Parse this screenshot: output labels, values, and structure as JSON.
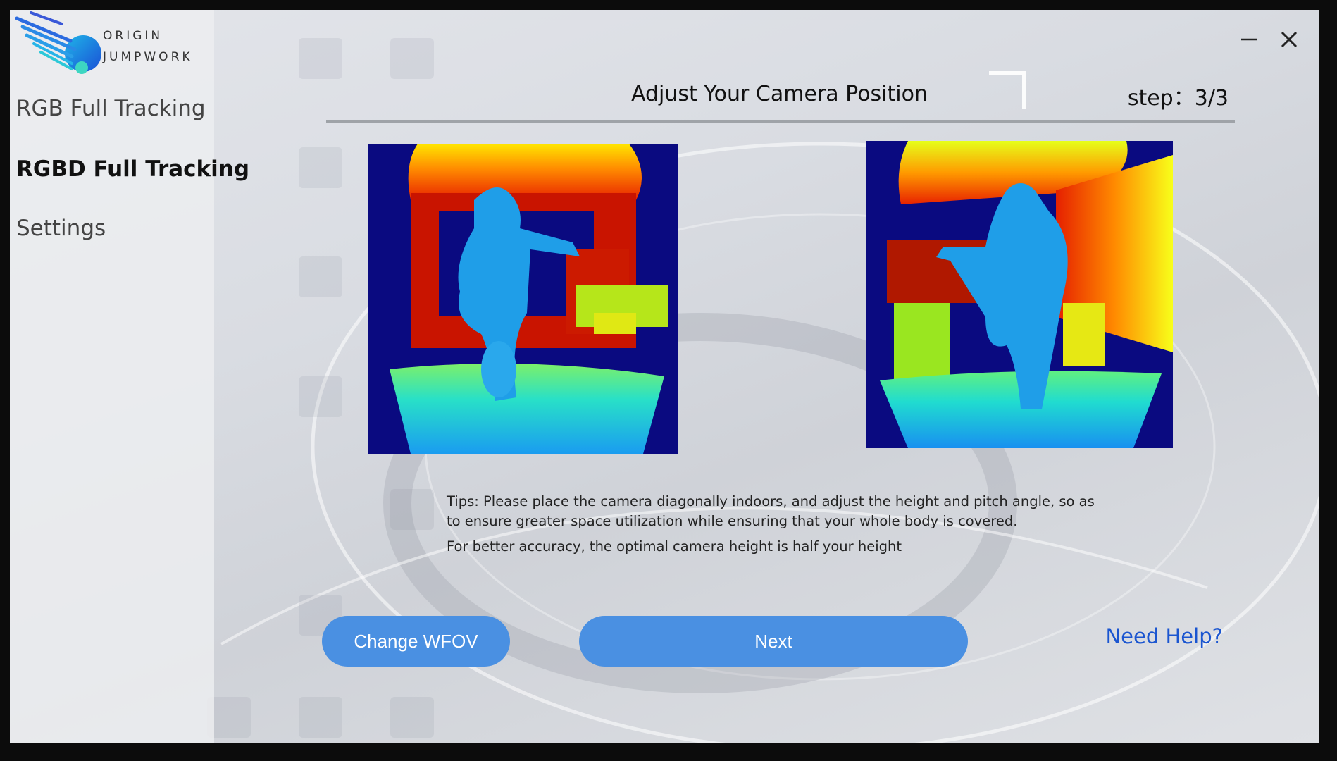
{
  "app": {
    "logo_line1": "ORIGIN",
    "logo_line2": "JUMPWORK"
  },
  "sidebar": {
    "items": [
      {
        "label": "RGB Full Tracking",
        "active": false
      },
      {
        "label": "RGBD Full Tracking",
        "active": true
      },
      {
        "label": "Settings",
        "active": false
      }
    ]
  },
  "window_controls": {
    "minimize_icon": "minimize-icon",
    "close_icon": "close-icon"
  },
  "header": {
    "title": "Adjust Your Camera Position",
    "step": "step：3/3"
  },
  "images": [
    {
      "name": "depth-view-front",
      "icon": "depth-camera-image"
    },
    {
      "name": "depth-view-side",
      "icon": "depth-camera-image"
    }
  ],
  "tips": {
    "line1": "Tips: Please place the camera diagonally indoors, and adjust the height and pitch angle, so as to ensure greater space utilization while ensuring that your whole body is covered.",
    "line2": "For better accuracy, the optimal camera height is half your height"
  },
  "actions": {
    "change_wfov": "Change WFOV",
    "next": "Next",
    "help": "Need Help?"
  },
  "colors": {
    "accent": "#4a90e2",
    "link": "#1a55d0",
    "depth_background": "#0a0a80"
  }
}
